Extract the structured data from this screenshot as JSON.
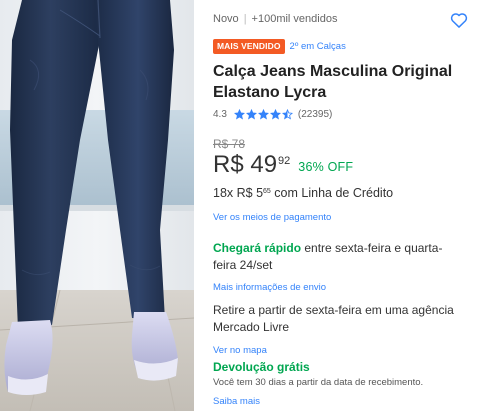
{
  "product_image": {
    "icon": "jeans-product-photo"
  },
  "meta": {
    "condition": "Novo",
    "separator": "|",
    "sold": "+100mil vendidos"
  },
  "favorite": {
    "icon": "heart-outline-icon"
  },
  "badge": {
    "label": "MAIS VENDIDO",
    "color": "#f35a24"
  },
  "ranking": {
    "label": "2º em Calças"
  },
  "title": "Calça Jeans Masculina Original Elastano Lycra",
  "rating": {
    "score": "4.3",
    "stars": 4.3,
    "reviews": "(22395)",
    "star_color": "#3483fa"
  },
  "price": {
    "old": "R$ 78",
    "current": "R$ 49",
    "cents": "92",
    "discount": "36% OFF",
    "installments_prefix": "18x R$ 5",
    "installments_cents": "65",
    "installments_suffix": " com Linha de Crédito"
  },
  "payment_link": "Ver os meios de pagamento",
  "shipping": {
    "highlight": "Chegará rápido",
    "text": " entre sexta-feira e quarta-feira 24/set",
    "link": "Mais informações de envio"
  },
  "pickup": {
    "text": "Retire a partir de sexta-feira em uma agência Mercado Livre",
    "link": "Ver no mapa"
  },
  "returns": {
    "title": "Devolução grátis",
    "text": "Você tem 30 dias a partir da data de recebimento.",
    "link": "Saiba mais"
  },
  "colors": {
    "link": "#3483fa",
    "green": "#00a650",
    "text": "#333333"
  }
}
